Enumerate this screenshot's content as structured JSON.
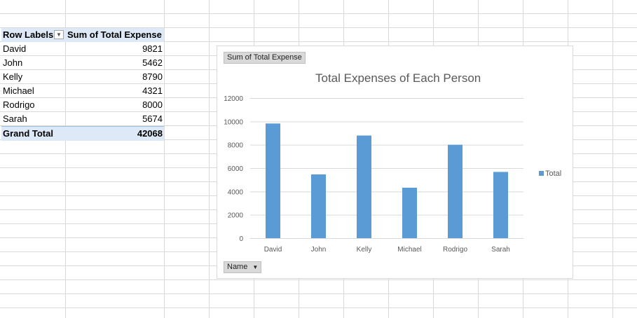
{
  "pivot": {
    "header": {
      "row_labels": "Row Labels",
      "value_field": "Sum of Total Expense"
    },
    "rows": [
      {
        "label": "David",
        "value": "9821"
      },
      {
        "label": "John",
        "value": "5462"
      },
      {
        "label": "Kelly",
        "value": "8790"
      },
      {
        "label": "Michael",
        "value": "4321"
      },
      {
        "label": "Rodrigo",
        "value": "8000"
      },
      {
        "label": "Sarah",
        "value": "5674"
      }
    ],
    "grand_total": {
      "label": "Grand Total",
      "value": "42068"
    }
  },
  "chart": {
    "value_field_button": "Sum of Total Expense",
    "axis_field_button": "Name",
    "legend_label": "Total",
    "bar_color": "#5b9bd5"
  },
  "chart_data": {
    "type": "bar",
    "title": "Total Expenses of Each Person",
    "categories": [
      "David",
      "John",
      "Kelly",
      "Michael",
      "Rodrigo",
      "Sarah"
    ],
    "series": [
      {
        "name": "Total",
        "values": [
          9821,
          5462,
          8790,
          4321,
          8000,
          5674
        ]
      }
    ],
    "ylim": [
      0,
      12000
    ],
    "yticks": [
      "0",
      "2000",
      "4000",
      "6000",
      "8000",
      "10000",
      "12000"
    ],
    "grid": true,
    "legend": "right"
  }
}
